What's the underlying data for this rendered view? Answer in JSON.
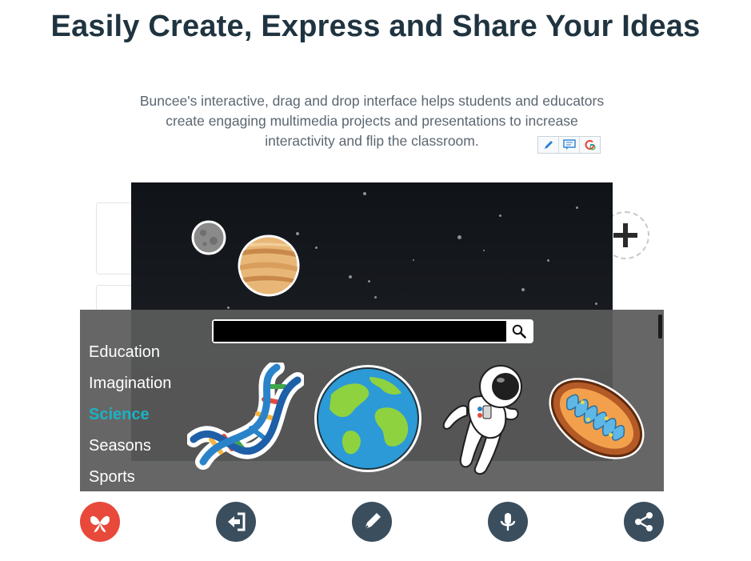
{
  "hero": {
    "title": "Easily Create, Express and Share Your Ideas",
    "description": "Buncee's interactive, drag and drop interface helps students and educators create engaging multimedia projects and presentations to increase interactivity and flip the classroom."
  },
  "extension_toolbar": [
    "pencil-icon",
    "comment-icon",
    "google-search-icon"
  ],
  "search": {
    "value": "",
    "placeholder": ""
  },
  "categories": [
    {
      "label": "Education",
      "active": false
    },
    {
      "label": "Imagination",
      "active": false
    },
    {
      "label": "Science",
      "active": true
    },
    {
      "label": "Seasons",
      "active": false
    },
    {
      "label": "Sports",
      "active": false
    }
  ],
  "stickers": [
    "dna-sticker",
    "earth-sticker",
    "astronaut-sticker",
    "mitochondria-sticker"
  ],
  "canvas_objects": [
    "moon",
    "jupiter"
  ],
  "bottom_toolbar": [
    "buncee-logo-icon",
    "export-icon",
    "pen-icon",
    "microphone-icon",
    "share-icon"
  ],
  "colors": {
    "headline": "#1f3440",
    "active_category": "#1bb3c4",
    "brand": "#e8493a",
    "toolbar_button": "#3a4e5e"
  }
}
